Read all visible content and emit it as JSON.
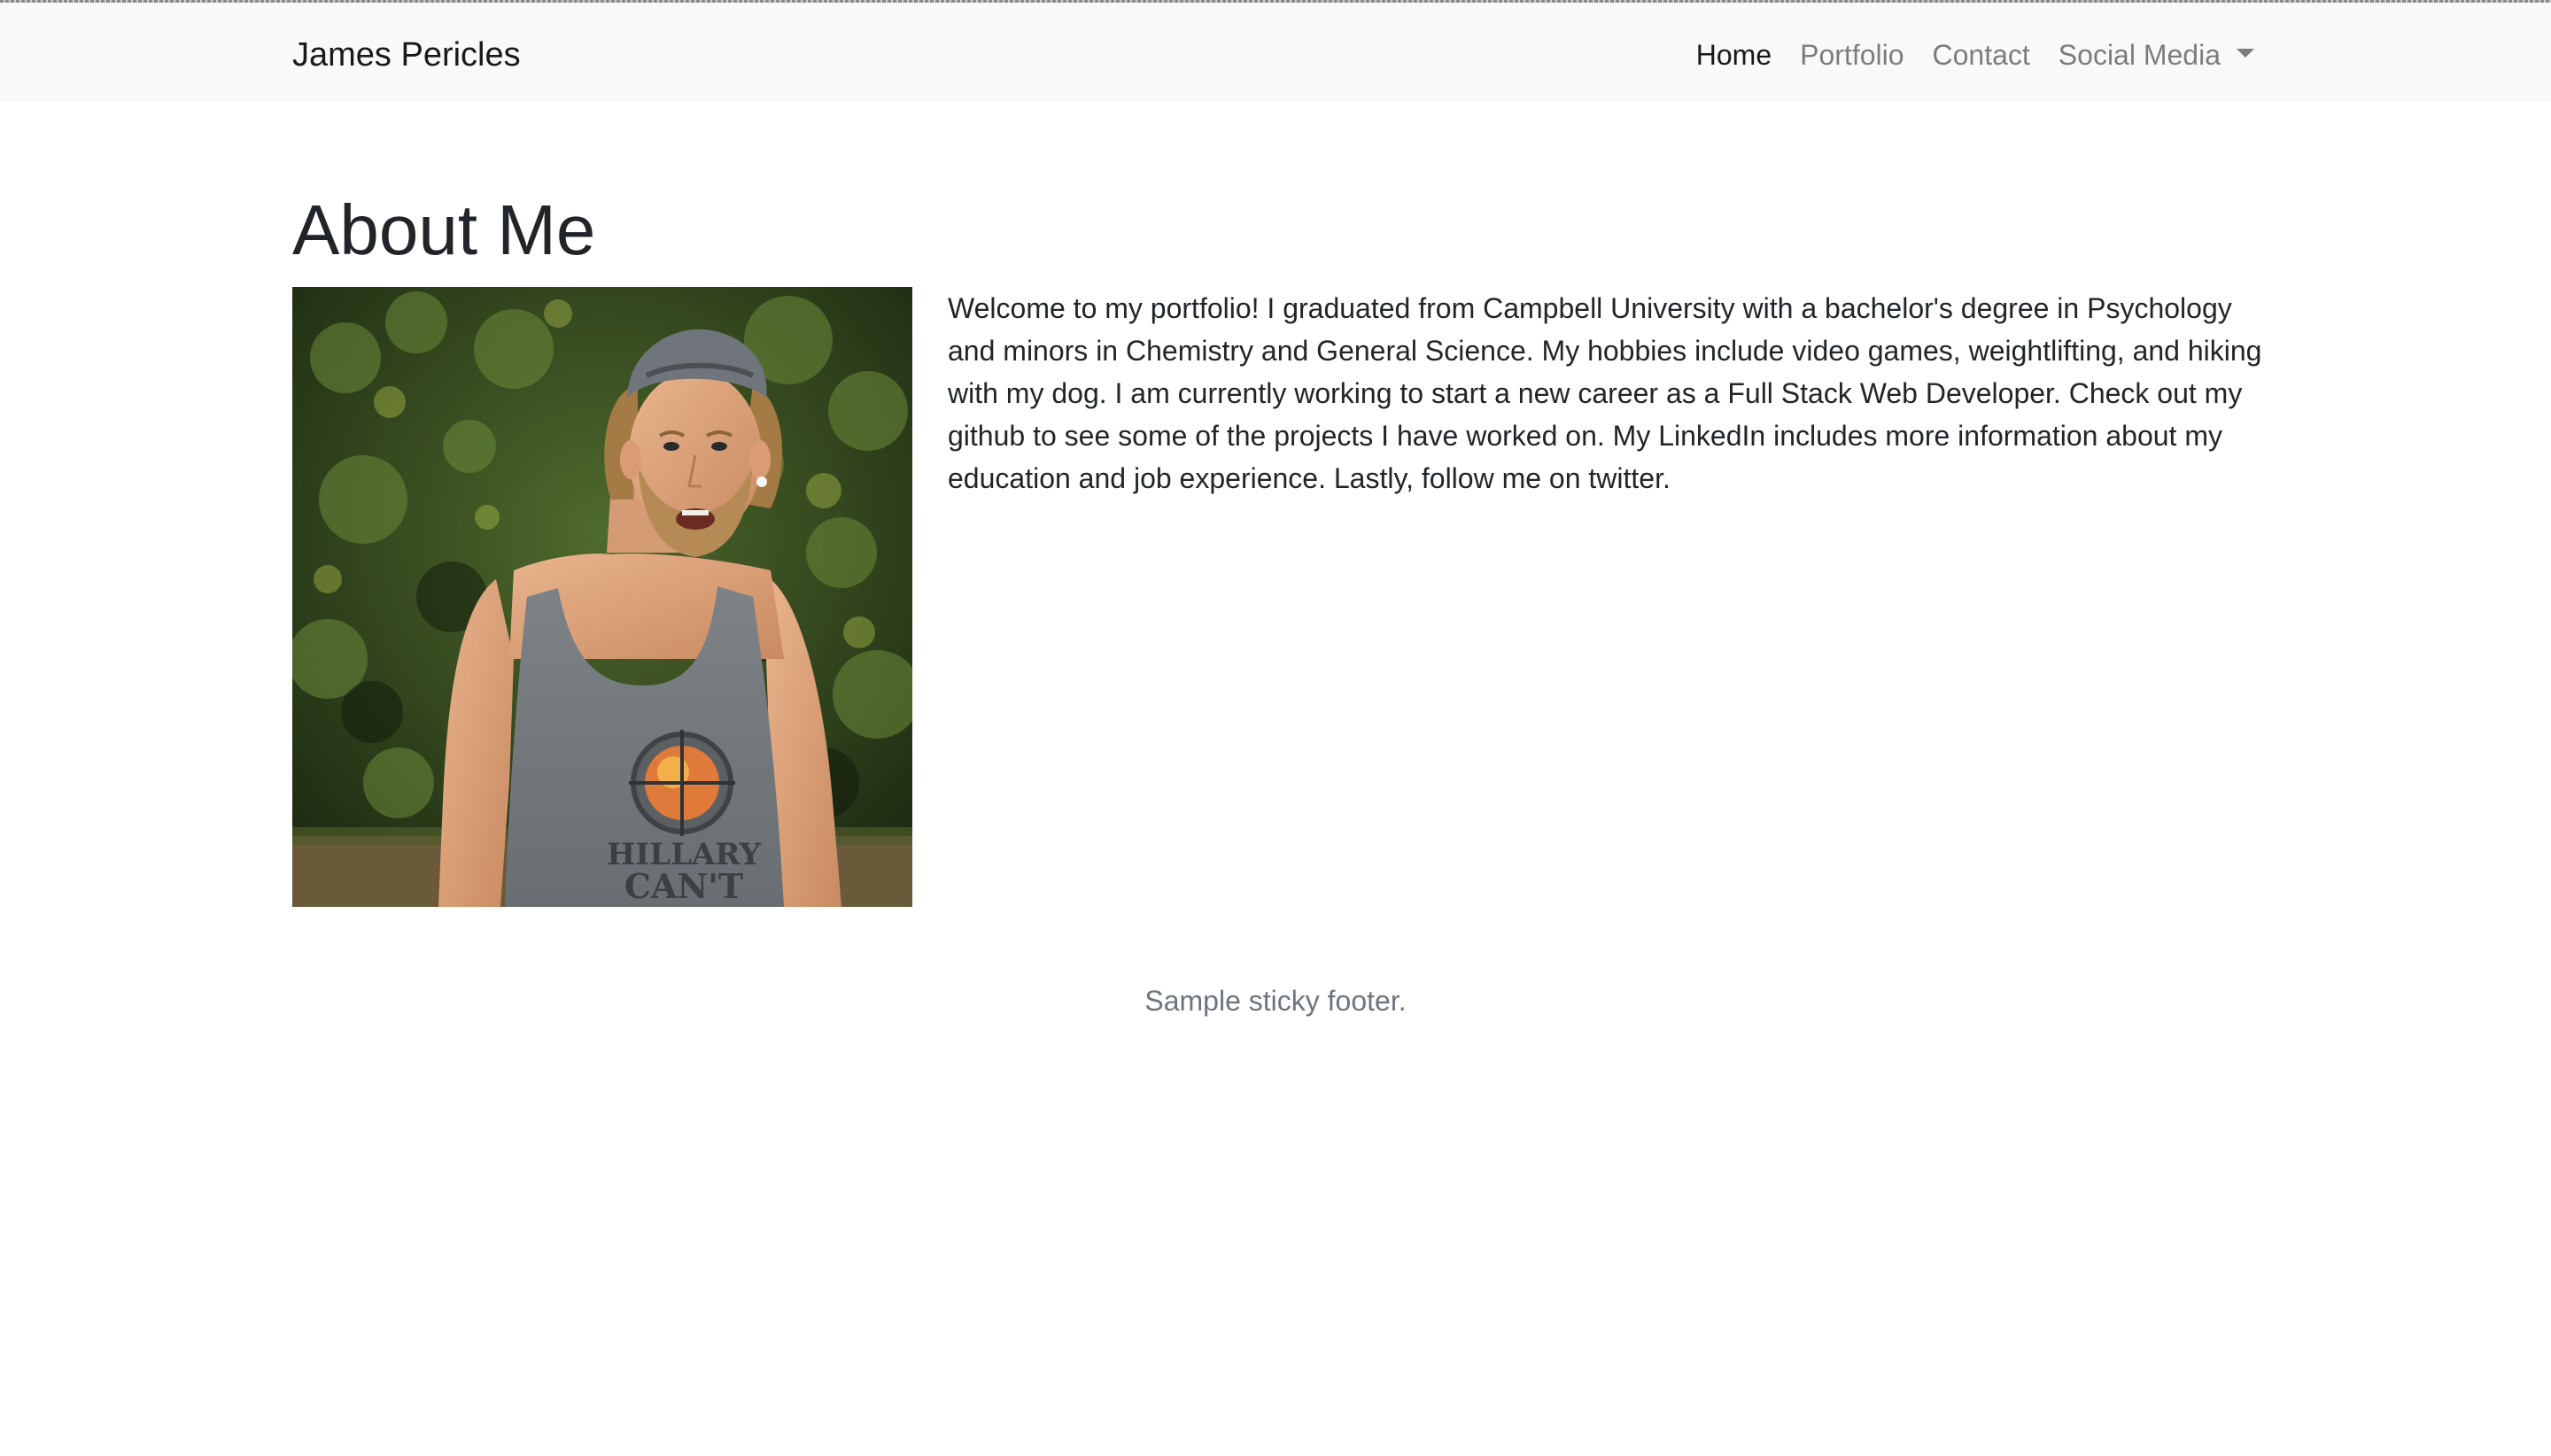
{
  "navbar": {
    "brand": "James Pericles",
    "links": [
      {
        "label": "Home",
        "active": true
      },
      {
        "label": "Portfolio",
        "active": false
      },
      {
        "label": "Contact",
        "active": false
      }
    ],
    "dropdown": {
      "label": "Social Media",
      "icon": "caret-down-icon"
    }
  },
  "main": {
    "heading": "About Me",
    "bio": "Welcome to my portfolio! I graduated from Campbell University with a bachelor's degree in Psychology and minors in Chemistry and General Science. My hobbies include video games, weightlifting, and hiking with my dog. I am currently working to start a new career as a Full Stack Web Developer. Check out my github to see some of the projects I have worked on. My LinkedIn includes more information about my education and job experience. Lastly, follow me on twitter.",
    "photo": {
      "shirt_text_line1": "HILLARY",
      "shirt_text_line2": "CAN'T"
    }
  },
  "footer": {
    "text": "Sample sticky footer."
  },
  "colors": {
    "navbar_bg": "#f8f9fa",
    "text": "#212529",
    "muted": "#6c757d"
  }
}
